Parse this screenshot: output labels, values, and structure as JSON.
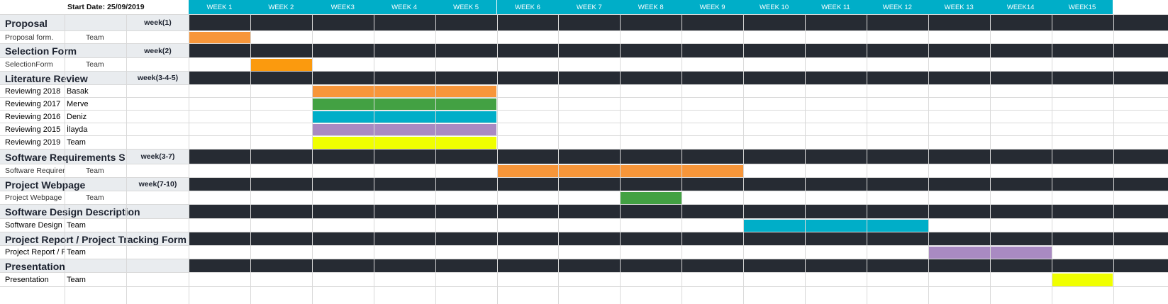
{
  "sheet": {
    "start_date_label": "Start Date: 25/09/2019",
    "weeks": [
      "WEEK 1",
      "WEEK 2",
      "WEEK3",
      "WEEK 4",
      "WEEK 5",
      "WEEK 6",
      "WEEK 7",
      "WEEK 8",
      "WEEK 9",
      "WEEK 10",
      "WEEK 11",
      "WEEK 12",
      "WEEK 13",
      "WEEK14",
      "WEEK15"
    ],
    "rows": [
      {
        "kind": "header",
        "title": "Proposal",
        "badge": "week(1)"
      },
      {
        "kind": "task",
        "name": "Proposal form.",
        "owner": "Team",
        "bar": {
          "start": 1,
          "end": 1,
          "color": "#f7963a"
        },
        "small": true
      },
      {
        "kind": "header",
        "title": "Selection Form",
        "badge": "week(2)"
      },
      {
        "kind": "task",
        "name": "SelectionForm",
        "owner": "Team",
        "bar": {
          "start": 2,
          "end": 2,
          "color": "#fb9a0e"
        },
        "small": true
      },
      {
        "kind": "header",
        "title": "Literature Review",
        "badge": "week(3-4-5)"
      },
      {
        "kind": "task",
        "name": "Reviewing 2018",
        "owner": "Basak",
        "bar": {
          "start": 3,
          "end": 5,
          "color": "#f7963a"
        }
      },
      {
        "kind": "task",
        "name": "Reviewing 2017",
        "owner": "Merve",
        "bar": {
          "start": 3,
          "end": 5,
          "color": "#43a143"
        }
      },
      {
        "kind": "task",
        "name": "Reviewing 2016",
        "owner": "Deniz",
        "bar": {
          "start": 3,
          "end": 5,
          "color": "#00aec8"
        }
      },
      {
        "kind": "task",
        "name": "Reviewing 2015",
        "owner": "İlayda",
        "bar": {
          "start": 3,
          "end": 5,
          "color": "#a98ac2"
        }
      },
      {
        "kind": "task",
        "name": "Reviewing 2019",
        "owner": "Team",
        "bar": {
          "start": 3,
          "end": 5,
          "color": "#f0ff00"
        }
      },
      {
        "kind": "header",
        "title": "Software Requirements S",
        "badge": "week(3-7)"
      },
      {
        "kind": "task",
        "name": "Software Requirer",
        "owner": "Team",
        "bar": {
          "start": 6,
          "end": 9,
          "color": "#f7963a"
        },
        "small": true
      },
      {
        "kind": "header",
        "title": "Project Webpage",
        "badge": "week(7-10)"
      },
      {
        "kind": "task",
        "name": "Project Webpage",
        "owner": "Team",
        "bar": {
          "start": 8,
          "end": 8,
          "color": "#43a143"
        },
        "small": true
      },
      {
        "kind": "header",
        "title": "Software Design Description",
        "badge": ""
      },
      {
        "kind": "task",
        "name": "Software Design",
        "owner": "Team",
        "bar": {
          "start": 10,
          "end": 12,
          "color": "#00aec8"
        }
      },
      {
        "kind": "header",
        "title": "Project Report / Project Tracking Form",
        "badge": ""
      },
      {
        "kind": "task",
        "name": "Project Report / F",
        "owner": "Team",
        "bar": {
          "start": 13,
          "end": 14,
          "color": "#a98ac2"
        }
      },
      {
        "kind": "header",
        "title": "Presentation",
        "badge": ""
      },
      {
        "kind": "task",
        "name": "Presentation",
        "owner": "Team",
        "bar": {
          "start": 15,
          "end": 15,
          "color": "#f0ff00"
        }
      }
    ],
    "colors": {
      "week_header": "#00aec8",
      "section_bar": "#262b33",
      "section_label_bg": "#e9ecef",
      "grid": "#d9d9d9"
    }
  }
}
